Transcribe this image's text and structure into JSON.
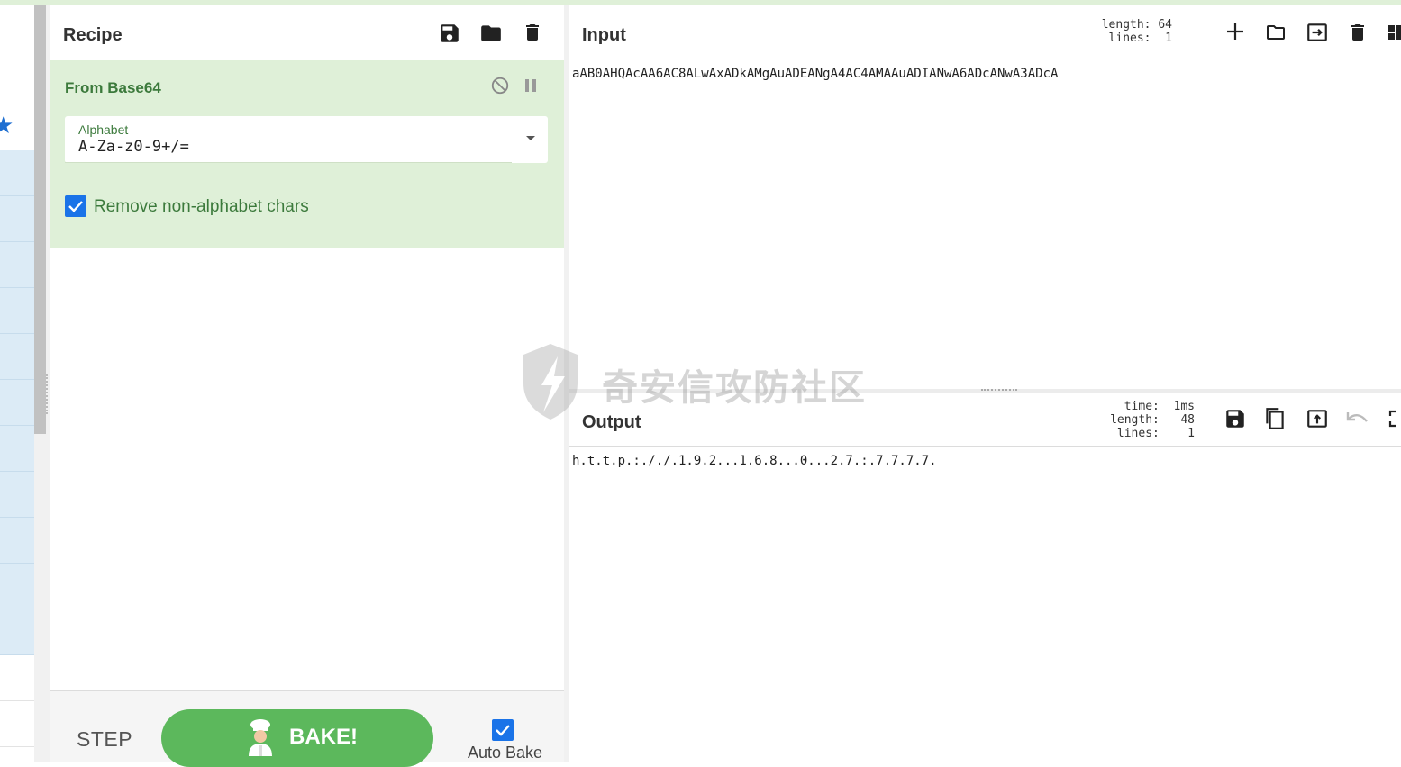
{
  "recipe": {
    "title": "Recipe",
    "operation": {
      "name": "From Base64",
      "alphabet_label": "Alphabet",
      "alphabet_value": "A-Za-z0-9+/=",
      "remove_label": "Remove non-alphabet chars",
      "remove_checked": true
    },
    "controls": {
      "step_label": "STEP",
      "bake_label": "BAKE!",
      "auto_bake_label": "Auto Bake",
      "auto_bake_checked": true
    }
  },
  "input": {
    "title": "Input",
    "stats": "length: 64\n lines:  1",
    "text": "aAB0AHQAcAA6AC8ALwAxADkAMgAuADEANgA4AC4AMAAuADIANwA6ADcANwA3ADcA"
  },
  "output": {
    "title": "Output",
    "stats": "  time:  1ms\nlength:   48\n lines:    1",
    "text": "h.t.t.p.:././.1.9.2...1.6.8...0...2.7.:.7.7.7.7."
  },
  "watermark": {
    "text": "奇安信攻防社区"
  },
  "icons": {
    "save": "save-icon",
    "load": "folder-icon",
    "clear": "trash-icon",
    "disable": "disable-icon",
    "pause": "pause-icon",
    "add": "plus-icon",
    "open": "folder-icon",
    "replace": "replace-input-icon",
    "layout": "layout-icon",
    "copy": "copy-icon",
    "move": "move-to-input-icon",
    "undo": "undo-icon",
    "maximise": "maximise-icon"
  },
  "colors": {
    "accent": "#1a73e8",
    "operation_bg": "#dff0d8",
    "operation_text": "#3c7a3c",
    "bake": "#5cb85c"
  }
}
